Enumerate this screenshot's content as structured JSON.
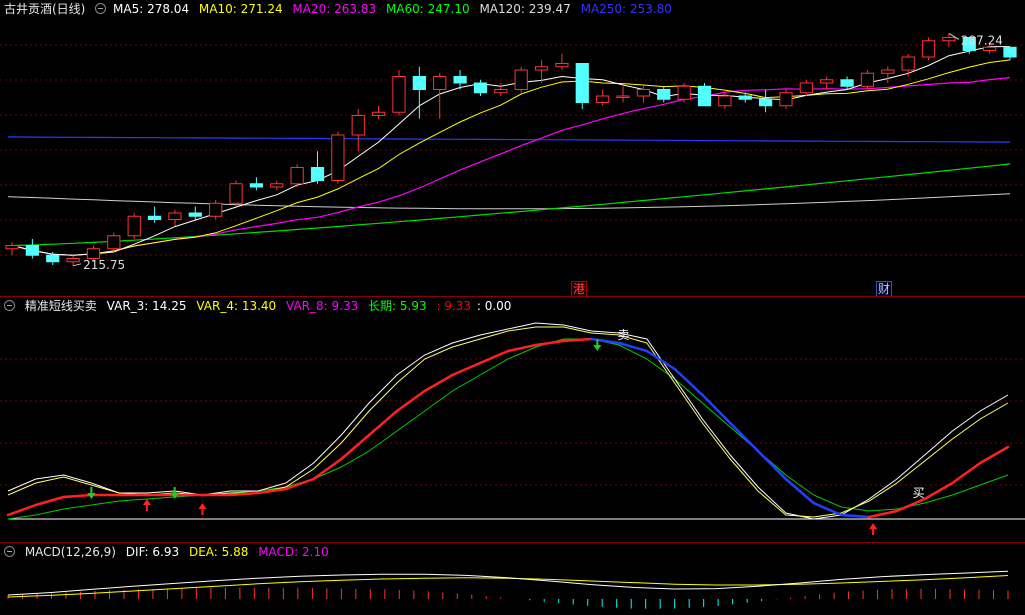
{
  "main": {
    "title": "古井贡酒(日线)",
    "ma": [
      {
        "label": "MA5: 278.04",
        "color": "#ffffff"
      },
      {
        "label": "MA10: 271.24",
        "color": "#ffff00"
      },
      {
        "label": "MA20: 263.83",
        "color": "#ff00ff"
      },
      {
        "label": "MA60: 247.10",
        "color": "#00ff00"
      },
      {
        "label": "MA120: 239.47",
        "color": "#dddddd"
      },
      {
        "label": "MA250: 253.80",
        "color": "#3333ff"
      }
    ],
    "high_label": "287.24",
    "low_label": "215.75",
    "events": [
      {
        "text": "港"
      },
      {
        "text": "财"
      }
    ]
  },
  "signal": {
    "title": "精准短线买卖",
    "items": [
      {
        "label": "VAR_3: 14.25",
        "color": "#ffffff"
      },
      {
        "label": "VAR_4: 13.40",
        "color": "#ffff00"
      },
      {
        "label": "VAR_8: 9.33",
        "color": "#ff00ff"
      },
      {
        "label": "长期: 5.93",
        "color": "#00ff00"
      },
      {
        "label": ": 9.33",
        "color": "#ff0000"
      },
      {
        "label": ": 0.00",
        "color": "#ffffff"
      }
    ],
    "sell_text": "卖",
    "buy_text": "买"
  },
  "macd": {
    "title": "MACD(12,26,9)",
    "items": [
      {
        "label": "DIF: 6.93",
        "color": "#ffffff"
      },
      {
        "label": "DEA: 5.88",
        "color": "#ffff00"
      },
      {
        "label": "MACD: 2.10",
        "color": "#ff00ff"
      }
    ]
  },
  "chart_data": [
    {
      "type": "candlestick",
      "title": "古井贡酒(日线)",
      "ohlc": [
        [
          221,
          223,
          219,
          222
        ],
        [
          222,
          224,
          218,
          219
        ],
        [
          219,
          220,
          216,
          217
        ],
        [
          217,
          219,
          215.75,
          218
        ],
        [
          218,
          222,
          217,
          221
        ],
        [
          221,
          226,
          220,
          225
        ],
        [
          225,
          232,
          224,
          231
        ],
        [
          231,
          234,
          229,
          230
        ],
        [
          230,
          233,
          228,
          232
        ],
        [
          232,
          234,
          230,
          231
        ],
        [
          231,
          236,
          230,
          235
        ],
        [
          235,
          242,
          234,
          241
        ],
        [
          241,
          243,
          239,
          240
        ],
        [
          240,
          242,
          239,
          241
        ],
        [
          241,
          247,
          240,
          246
        ],
        [
          246,
          251,
          241,
          242
        ],
        [
          242,
          257,
          241,
          256
        ],
        [
          256,
          264,
          251,
          262
        ],
        [
          262,
          265,
          261,
          263
        ],
        [
          263,
          276,
          262,
          274
        ],
        [
          274,
          277,
          261,
          270
        ],
        [
          270,
          275,
          261,
          274
        ],
        [
          274,
          276,
          270,
          272
        ],
        [
          272,
          273,
          268,
          269
        ],
        [
          269,
          272,
          268,
          270
        ],
        [
          270,
          277,
          269,
          276
        ],
        [
          276,
          279,
          272,
          277
        ],
        [
          277,
          281,
          276,
          278
        ],
        [
          278,
          278,
          264,
          266
        ],
        [
          266,
          270,
          265,
          268
        ],
        [
          268,
          271,
          266,
          268
        ],
        [
          268,
          271,
          266,
          270
        ],
        [
          270,
          271,
          266,
          267
        ],
        [
          267,
          272,
          266,
          271
        ],
        [
          271,
          272,
          266,
          265
        ],
        [
          265,
          269,
          264,
          268
        ],
        [
          268,
          269,
          266,
          267
        ],
        [
          267,
          270,
          263,
          265
        ],
        [
          265,
          270,
          264,
          269
        ],
        [
          269,
          273,
          268,
          272
        ],
        [
          272,
          274,
          270,
          273
        ],
        [
          273,
          274,
          270,
          271
        ],
        [
          271,
          276,
          270,
          275
        ],
        [
          275,
          277,
          272,
          276
        ],
        [
          276,
          281,
          274,
          280
        ],
        [
          280,
          286,
          279,
          285
        ],
        [
          285,
          287.24,
          283,
          286
        ],
        [
          286,
          286,
          281,
          282
        ],
        [
          282,
          284,
          281,
          283
        ],
        [
          283,
          283,
          279,
          280
        ]
      ],
      "ma_values": {
        "MA5": 278.04,
        "MA10": 271.24,
        "MA20": 263.83,
        "MA60": 247.1,
        "MA120": 239.47,
        "MA250": 253.8
      },
      "high": 287.24,
      "low": 215.75
    },
    {
      "type": "line",
      "title": "精准短线买卖",
      "series": [
        {
          "name": "VAR_3",
          "values": [
            14,
            20,
            22,
            18,
            13,
            13,
            14,
            12,
            14,
            14,
            18,
            28,
            42,
            58,
            72,
            82,
            88,
            92,
            95,
            98,
            97,
            94,
            93,
            90,
            70,
            50,
            32,
            16,
            3,
            0,
            2,
            10,
            20,
            32,
            44,
            54,
            62
          ]
        },
        {
          "name": "VAR_4",
          "values": [
            12,
            18,
            21,
            17,
            13,
            12,
            13,
            12,
            13,
            13,
            16,
            25,
            38,
            54,
            68,
            80,
            86,
            90,
            94,
            96,
            96,
            93,
            92,
            88,
            68,
            48,
            30,
            14,
            2,
            1,
            3,
            9,
            18,
            29,
            40,
            50,
            58
          ]
        },
        {
          "name": "VAR_8",
          "values": [
            2,
            7,
            11,
            12,
            12,
            12,
            12,
            12,
            12,
            13,
            15,
            20,
            30,
            42,
            54,
            64,
            72,
            78,
            84,
            87,
            89,
            90,
            88,
            84,
            75,
            62,
            48,
            34,
            20,
            8,
            2,
            1,
            4,
            10,
            18,
            28,
            36
          ]
        },
        {
          "name": "长期",
          "values": [
            0,
            2,
            5,
            7,
            9,
            10,
            11,
            12,
            13,
            14,
            16,
            20,
            26,
            34,
            44,
            54,
            64,
            72,
            80,
            86,
            90,
            90,
            87,
            80,
            70,
            58,
            46,
            34,
            22,
            12,
            6,
            4,
            5,
            8,
            12,
            17,
            22
          ]
        }
      ],
      "ylim": [
        0,
        100
      ]
    },
    {
      "type": "bar",
      "title": "MACD(12,26,9)",
      "series": [
        {
          "name": "DIF",
          "values": [
            1.0,
            1.6,
            2.4,
            3.2,
            3.9,
            4.6,
            5.2,
            5.7,
            6.0,
            6.2,
            6.2,
            5.9,
            5.3,
            4.5,
            3.6,
            2.9,
            2.5,
            2.6,
            3.2,
            4.0,
            4.9,
            5.6,
            6.1,
            6.5,
            6.93
          ]
        },
        {
          "name": "DEA",
          "values": [
            0.5,
            0.9,
            1.4,
            2.0,
            2.6,
            3.2,
            3.8,
            4.3,
            4.7,
            5.0,
            5.2,
            5.3,
            5.2,
            4.9,
            4.5,
            4.1,
            3.7,
            3.5,
            3.5,
            3.7,
            4.0,
            4.4,
            4.8,
            5.3,
            5.88
          ]
        },
        {
          "name": "MACD",
          "values": [
            1.0,
            1.4,
            2.0,
            2.4,
            2.6,
            2.8,
            2.8,
            2.8,
            2.6,
            2.4,
            2.0,
            1.2,
            0.2,
            -0.8,
            -1.8,
            -2.4,
            -2.4,
            -1.8,
            -0.6,
            0.6,
            1.8,
            2.4,
            2.6,
            2.4,
            2.1
          ]
        }
      ]
    }
  ]
}
